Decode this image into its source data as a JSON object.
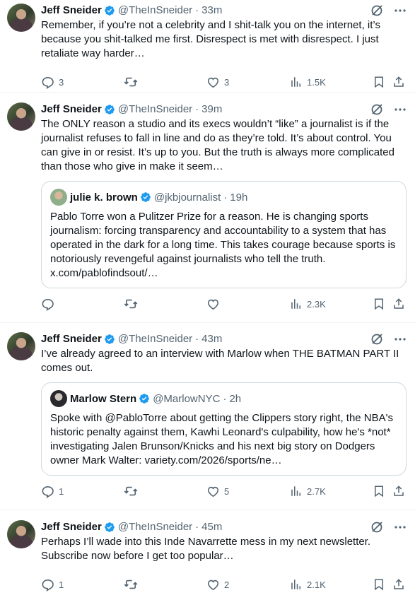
{
  "tweets": [
    {
      "name": "Jeff Sneider",
      "handle": "@TheInSneider",
      "time": "33m",
      "text": "Remember, if you’re not a celebrity and I shit-talk you on the internet, it’s because you shit-talked me first. Disrespect is met with disrespect. I just retaliate way harder…",
      "replies": "3",
      "retweets": "",
      "likes": "3",
      "views": "1.5K"
    },
    {
      "name": "Jeff Sneider",
      "handle": "@TheInSneider",
      "time": "39m",
      "text": "The ONLY reason a studio and its execs wouldn’t “like” a journalist is if the journalist refuses to fall in line and do as they’re told. It’s about control. You can give in or resist. It’s up to you. But the truth is always more complicated than those who give in make it seem…",
      "quote": {
        "name": "julie k. brown",
        "handle": "@jkbjournalist",
        "time": "19h",
        "text": "Pablo Torre won a Pulitzer Prize for a reason. He is changing sports journalism: forcing transparency and accountability to a system that has operated in the dark for a long time. This takes courage because sports is notoriously revengeful against journalists who tell the truth. x.com/pablofindsout/…"
      },
      "replies": "",
      "retweets": "",
      "likes": "",
      "views": "2.3K"
    },
    {
      "name": "Jeff Sneider",
      "handle": "@TheInSneider",
      "time": "43m",
      "text": "I’ve already agreed to an interview with Marlow when THE BATMAN PART II comes out.",
      "quote": {
        "name": "Marlow Stern",
        "handle": "@MarlowNYC",
        "time": "2h",
        "text": "Spoke with @PabloTorre about getting the Clippers story right, the NBA's historic penalty against them, Kawhi Leonard's culpability, how he's *not* investigating Jalen Brunson/Knicks and his next big story on Dodgers owner Mark Walter: variety.com/2026/sports/ne…"
      },
      "replies": "1",
      "retweets": "",
      "likes": "5",
      "views": "2.7K"
    },
    {
      "name": "Jeff Sneider",
      "handle": "@TheInSneider",
      "time": "45m",
      "text": "Perhaps I’ll wade into this Inde Navarrette mess in my next newsletter. Subscribe now before I get too popular…",
      "replies": "1",
      "retweets": "",
      "likes": "2",
      "views": "2.1K"
    }
  ],
  "separator": "·",
  "colors": {
    "verified": "#1d9bf0",
    "text": "#0f1419",
    "secondary": "#536471",
    "border": "#cfd9de"
  },
  "icons": [
    "verified-badge-icon",
    "grok-icon",
    "more-icon",
    "reply-icon",
    "retweet-icon",
    "like-icon",
    "views-icon",
    "bookmark-icon",
    "share-icon"
  ]
}
